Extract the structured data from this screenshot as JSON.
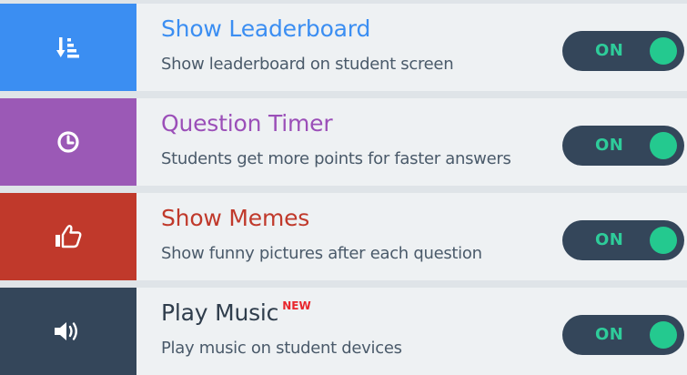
{
  "colors": {
    "row_background": "#eef1f3",
    "divider": "#dfe4e8",
    "toggle_background": "#34465a",
    "toggle_on": "#24c98f",
    "description_text": "#4a5a6a"
  },
  "settings": [
    {
      "title": "Show Leaderboard",
      "description": "Show leaderboard on student screen",
      "toggle": "ON",
      "icon": "leaderboard-sort-icon",
      "tile_color": "#3b8ef2",
      "title_color": "#3b8ef2"
    },
    {
      "title": "Question Timer",
      "description": "Students get more points for faster answers",
      "toggle": "ON",
      "icon": "clock-icon",
      "tile_color": "#9b59b6",
      "title_color": "#9b4fb8"
    },
    {
      "title": "Show Memes",
      "description": "Show funny pictures after each question",
      "toggle": "ON",
      "icon": "thumbs-up-icon",
      "tile_color": "#c0392b",
      "title_color": "#c0392b"
    },
    {
      "title": "Play Music",
      "badge": "NEW",
      "description": "Play music on student devices",
      "toggle": "ON",
      "icon": "speaker-icon",
      "tile_color": "#34465a",
      "title_color": "#2f3d4c"
    }
  ]
}
